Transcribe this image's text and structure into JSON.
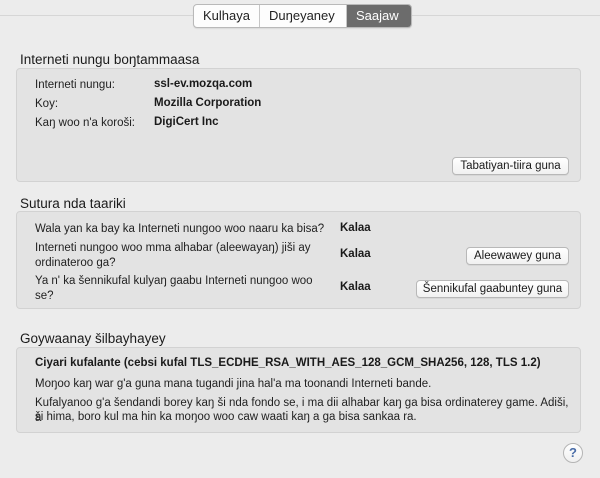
{
  "tabs": [
    {
      "label": "Kulhaya",
      "active": false
    },
    {
      "label": "Duŋeyaney",
      "active": false
    },
    {
      "label": "Saajaw",
      "active": true
    }
  ],
  "website": {
    "title": "Interneti nungu boŋtammaasa",
    "rows": [
      {
        "label": "Interneti nungu:",
        "value": "ssl-ev.mozqa.com"
      },
      {
        "label": "Koy:",
        "value": "Mozilla Corporation"
      },
      {
        "label": "Kaŋ woo n'a koroši:",
        "value": "DigiCert Inc"
      }
    ],
    "button": "Tabatiyan-tiira guna"
  },
  "privacy": {
    "title": "Sutura nda taariki",
    "rows": [
      {
        "label": "Wala yan ka bay ka Interneti nungoo woo naaru ka bisa?",
        "value": "Kalaa",
        "button": ""
      },
      {
        "label_line1": "Interneti nungoo woo mma alhabar (aleewayaŋ) jiši ay",
        "label_line2": "ordinateroo ga?",
        "value": "Kalaa",
        "button": "Aleewawey guna"
      },
      {
        "label_line1": "Ya n' ka šennikufal kulyaŋ gaabu Interneti nungoo woo",
        "label_line2": "se?",
        "value": "Kalaa",
        "button": "Šennikufal gaabuntey guna"
      }
    ]
  },
  "technical": {
    "title": "Goywaanay šilbayhayey",
    "strong": "Ciyari kufalante (cebsi kufal TLS_ECDHE_RSA_WITH_AES_128_GCM_SHA256, 128, TLS 1.2)",
    "line1": "Moŋoo kaŋ war g'a guna mana tugandi jina hal'a ma toonandi Interneti bande.",
    "line2a": "Kufalyanoo g'a šendandi borey kaŋ ši nda fondo se, i ma dii alhabar kaŋ ga bisa ordinaterey game. Adiši, a",
    "line2b": "ši hima, boro kul ma hin ka moŋoo woo caw waati kaŋ a ga bisa sankaa ra."
  },
  "help_icon": "?"
}
